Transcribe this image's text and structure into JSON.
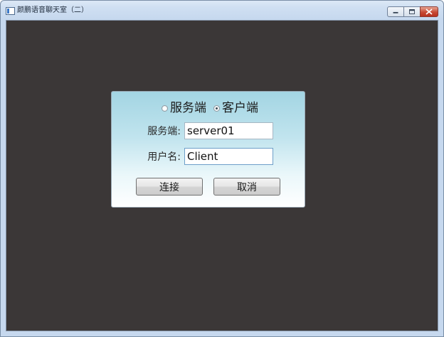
{
  "window": {
    "title": "颜鹏语音聊天室（二）"
  },
  "dialog": {
    "mode_options": [
      {
        "label": "服务端",
        "checked": false
      },
      {
        "label": "客户端",
        "checked": true
      }
    ],
    "server_field": {
      "label": "服务端:",
      "value": "server01"
    },
    "username_field": {
      "label": "用户名:",
      "value": "Client"
    },
    "connect_label": "连接",
    "cancel_label": "取消"
  },
  "colors": {
    "client_background": "#3b3737",
    "dialog_gradient_top": "#a3d5e3",
    "dialog_gradient_bottom": "#ffffff",
    "close_button": "#c74a34"
  }
}
